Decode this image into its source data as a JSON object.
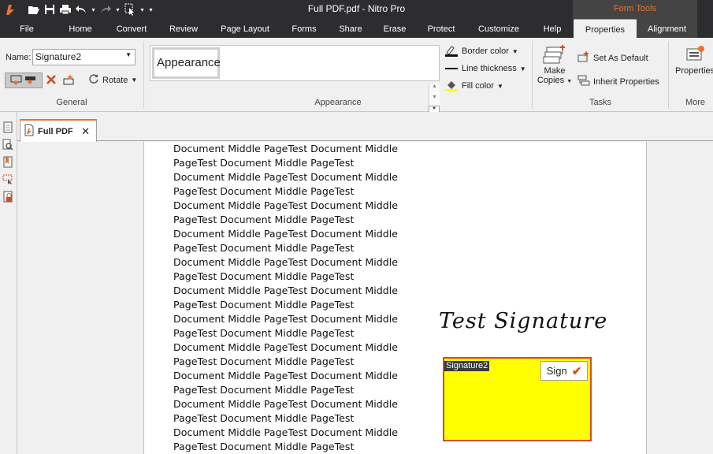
{
  "window": {
    "title": "Full PDF.pdf - Nitro Pro",
    "contextual_tab_group": "Form Tools"
  },
  "tabs": [
    {
      "label": "File"
    },
    {
      "label": "Home"
    },
    {
      "label": "Convert"
    },
    {
      "label": "Review"
    },
    {
      "label": "Page Layout"
    },
    {
      "label": "Forms"
    },
    {
      "label": "Share"
    },
    {
      "label": "Erase"
    },
    {
      "label": "Protect"
    },
    {
      "label": "Customize"
    },
    {
      "label": "Help"
    },
    {
      "label": "Properties",
      "active": true
    },
    {
      "label": "Alignment"
    }
  ],
  "ribbon": {
    "general": {
      "name_label": "Name:",
      "name_value": "Signature2",
      "rotate_label": "Rotate",
      "group_label": "General"
    },
    "appearance": {
      "gallery_item": "Appearance",
      "border_color": "Border color",
      "line_thickness": "Line thickness",
      "fill_color": "Fill color",
      "group_label": "Appearance"
    },
    "tasks": {
      "make_copies_line1": "Make",
      "make_copies_line2": "Copies",
      "set_as_default": "Set As Default",
      "inherit_properties": "Inherit Properties",
      "group_label": "Tasks"
    },
    "more": {
      "properties": "Properties",
      "group_label": "More"
    }
  },
  "document": {
    "tab_title": "Full PDF",
    "lines": [
      "Document Middle PageTest Document Middle",
      "PageTest Document Middle PageTest",
      "Document Middle PageTest Document Middle",
      "PageTest Document Middle PageTest",
      "Document Middle PageTest Document Middle",
      "PageTest Document Middle PageTest",
      "Document Middle PageTest Document Middle",
      "PageTest Document Middle PageTest",
      "Document Middle PageTest Document Middle",
      "PageTest Document Middle PageTest",
      "Document Middle PageTest Document Middle",
      "PageTest Document Middle PageTest",
      "Document Middle PageTest Document Middle",
      "PageTest Document Middle PageTest",
      "Document Middle PageTest Document Middle",
      "PageTest Document Middle PageTest",
      "Document Middle PageTest Document Middle",
      "PageTest Document Middle PageTest",
      "Document Middle PageTest Document Middle",
      "PageTest Document Middle PageTest",
      "Document Middle PageTest Document Middle",
      "PageTest Document Middle PageTest"
    ],
    "signature_text": "Test Signature",
    "signature_field": {
      "label": "Signature2",
      "sign_button": "Sign",
      "fill_color": "#ffff00",
      "border_color": "#d34d1e"
    }
  },
  "colors": {
    "accent": "#e8742e",
    "titlebar": "#2d2d30"
  }
}
